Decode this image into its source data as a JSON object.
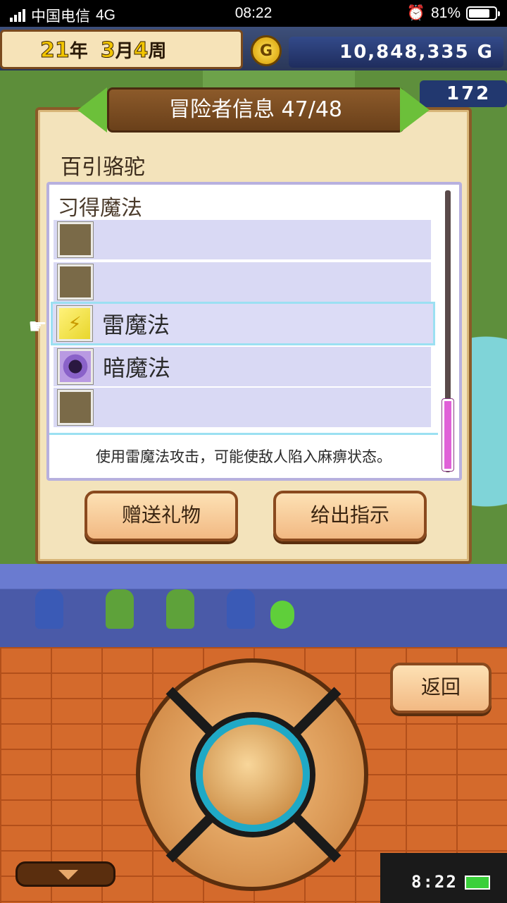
{
  "status_bar": {
    "carrier": "中国电信",
    "network": "4G",
    "time": "08:22",
    "battery": "81%",
    "battery_level": 0.81
  },
  "game_hud": {
    "year": "21",
    "year_unit": "年",
    "month": "3",
    "month_unit": "月",
    "week": "4",
    "week_unit": "周",
    "coin_symbol": "G",
    "gold": "10,848,335 G",
    "gems": "172"
  },
  "dialog": {
    "title": "冒险者信息 47/48",
    "adventurer_name": "百引骆驼",
    "section_title": "习得魔法",
    "magic_slots": [
      {
        "label": "",
        "icon": "empty-slot-icon"
      },
      {
        "label": "",
        "icon": "empty-slot-icon"
      },
      {
        "label": "雷魔法",
        "icon": "thunder-icon",
        "selected": true
      },
      {
        "label": "暗魔法",
        "icon": "dark-vortex-icon"
      },
      {
        "label": "",
        "icon": "empty-slot-icon"
      }
    ],
    "description": "使用雷魔法攻击，可能使敌人陷入麻痹状态。",
    "gift_button": "赠送礼物",
    "order_button": "给出指示"
  },
  "controls": {
    "back_button": "返回",
    "clock": "8:22"
  },
  "colors": {
    "accent_cyan": "#1fa9c6",
    "dialog_bg": "#f3e3bb",
    "scroll_thumb": "#e060d8"
  }
}
